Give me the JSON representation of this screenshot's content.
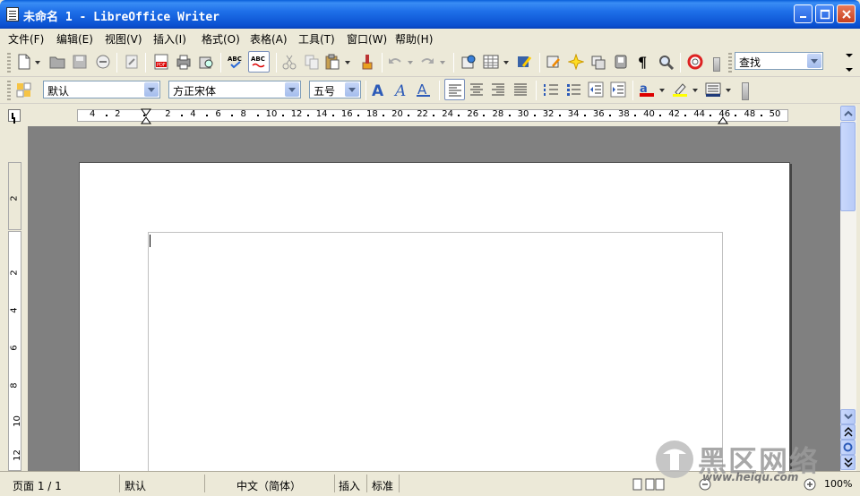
{
  "window": {
    "title": "未命名 1 - LibreOffice Writer"
  },
  "menu": [
    {
      "label": "文件(F)"
    },
    {
      "label": "编辑(E)"
    },
    {
      "label": "视图(V)"
    },
    {
      "label": "插入(I)"
    },
    {
      "label": "格式(O)"
    },
    {
      "label": "表格(A)"
    },
    {
      "label": "工具(T)"
    },
    {
      "label": "窗口(W)"
    },
    {
      "label": "帮助(H)"
    }
  ],
  "toolbar": {
    "find_placeholder": "查找"
  },
  "format": {
    "style": "默认",
    "font": "方正宋体",
    "size": "五号"
  },
  "ruler": {
    "labels": [
      "4",
      "2",
      "2",
      "4",
      "6",
      "8",
      "10",
      "12",
      "14",
      "16",
      "18",
      "20",
      "22",
      "24",
      "26",
      "28",
      "30",
      "32",
      "34",
      "36",
      "38",
      "40",
      "42",
      "44",
      "46",
      "48",
      "50"
    ],
    "vlabels": [
      "2",
      "2",
      "4",
      "6",
      "8",
      "10",
      "12"
    ]
  },
  "status": {
    "page": "页面 1 / 1",
    "style": "默认",
    "language": "中文（简体）",
    "mode": "插入",
    "selection": "标准",
    "zoom": "100%"
  },
  "watermark": {
    "text": "黑区网络",
    "url": "www.heiqu.com"
  },
  "colors": {
    "titlebar": "#0a4fd0",
    "workspace": "#808080",
    "chrome": "#ece9d8"
  }
}
